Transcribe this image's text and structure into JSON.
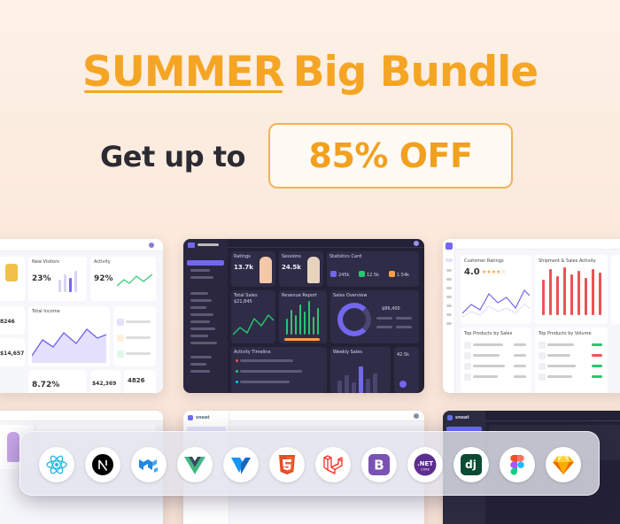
{
  "banner": {
    "headline_accent": "SUMMER",
    "headline_rest": "Big Bundle",
    "subline": "Get up to",
    "discount": "85% OFF"
  },
  "screens": {
    "top_left": {
      "stats": [
        "23%",
        "92%",
        "8246",
        "$14,657",
        "8.72%",
        "$42,369",
        "4826"
      ]
    },
    "top_middle": {
      "ratings_value": "13.7k",
      "sessions_value": "24.5k",
      "statistics_title": "Statistics Card",
      "stats": [
        "245k",
        "12.5k",
        "1.54k"
      ],
      "total_sales": "$21,845",
      "revenue_report": "Revenue Report",
      "sales_overview": "Sales Overview",
      "sales_value": "$86,400",
      "activity_timeline": "Activity Timeline",
      "weekly_sales": "Weekly Sales",
      "total_growth": "42.5k"
    },
    "top_right": {
      "customer_ratings": "Customer Ratings",
      "rating_value": "4.0",
      "rating_stars": 4,
      "sales_activity": "Shipment & Sales Activity",
      "top_products_sales": "Top Products by Sales",
      "top_products_volume": "Top Products by Volume"
    },
    "bottom_middle": {
      "brand": "sneat"
    },
    "bottom_right": {
      "brand": "sneat"
    }
  },
  "technologies": [
    {
      "name": "React",
      "icon": "react-icon",
      "color": "#22b7e0"
    },
    {
      "name": "Next.js",
      "icon": "nextjs-icon",
      "color": "#000000"
    },
    {
      "name": "MUI",
      "icon": "mui-icon",
      "color": "#1e88e5"
    },
    {
      "name": "Vue",
      "icon": "vue-icon",
      "color": "#41b883"
    },
    {
      "name": "Vuetify",
      "icon": "vuetify-icon",
      "color": "#1867c0"
    },
    {
      "name": "HTML5",
      "icon": "html5-icon",
      "color": "#e44d26"
    },
    {
      "name": "Laravel",
      "icon": "laravel-icon",
      "color": "#ff2d20"
    },
    {
      "name": "Bootstrap",
      "icon": "bootstrap-icon",
      "color": "#7952b3"
    },
    {
      "name": ".NET",
      "icon": "dotnet-icon",
      "color": "#5c2d91",
      "label": ".NET",
      "sublabel": "CORE"
    },
    {
      "name": "Django",
      "icon": "django-icon",
      "color": "#0c4b33",
      "label": "dj"
    },
    {
      "name": "Figma",
      "icon": "figma-icon",
      "color": "#f24e1e"
    },
    {
      "name": "Sketch",
      "icon": "sketch-icon",
      "color": "#fdb300"
    }
  ],
  "colors": {
    "accent": "#f5a524",
    "dark_text": "#2c2b33",
    "brand_purple": "#7367f0"
  }
}
